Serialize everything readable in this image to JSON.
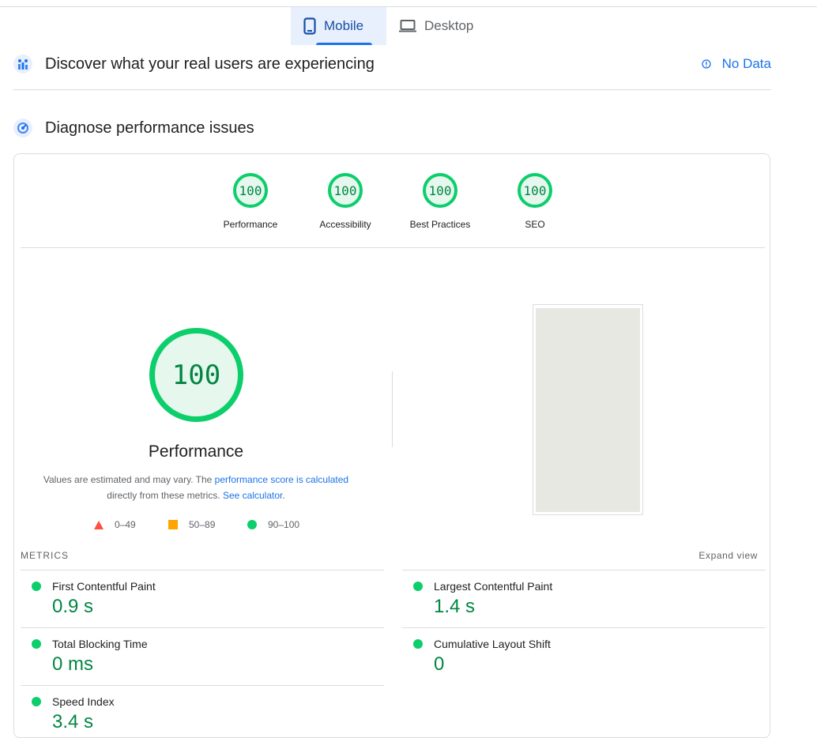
{
  "tabs": [
    {
      "label": "Mobile",
      "icon": "phone-icon",
      "active": true
    },
    {
      "label": "Desktop",
      "icon": "laptop-icon",
      "active": false
    }
  ],
  "field": {
    "title": "Discover what your real users are experiencing",
    "icon": "users-chart-icon",
    "status": "No Data",
    "status_icon": "info-icon"
  },
  "lab": {
    "title": "Diagnose performance issues",
    "icon": "gauge-icon"
  },
  "categories": [
    {
      "label": "Performance",
      "score": "100"
    },
    {
      "label": "Accessibility",
      "score": "100"
    },
    {
      "label": "Best Practices",
      "score": "100"
    },
    {
      "label": "SEO",
      "score": "100"
    }
  ],
  "performance": {
    "score": "100",
    "title": "Performance",
    "desc_1": "Values are estimated and may vary. The ",
    "desc_link_1": "performance score is calculated",
    "desc_2": " directly from these metrics. ",
    "desc_link_2": "See calculator",
    "desc_3": ".",
    "legend": [
      {
        "range": "0–49",
        "color": "#ff4e42",
        "shape": "triangle"
      },
      {
        "range": "50–89",
        "color": "#ffa400",
        "shape": "square"
      },
      {
        "range": "90–100",
        "color": "#0cce6b",
        "shape": "circle"
      }
    ]
  },
  "metrics": {
    "label": "METRICS",
    "expand": "Expand view",
    "items": [
      {
        "name": "First Contentful Paint",
        "value": "0.9 s"
      },
      {
        "name": "Largest Contentful Paint",
        "value": "1.4 s"
      },
      {
        "name": "Total Blocking Time",
        "value": "0 ms"
      },
      {
        "name": "Cumulative Layout Shift",
        "value": "0"
      },
      {
        "name": "Speed Index",
        "value": "3.4 s"
      }
    ]
  },
  "colors": {
    "pass": "#0cce6b",
    "pass_text": "#018642",
    "accent": "#1a73e8"
  }
}
